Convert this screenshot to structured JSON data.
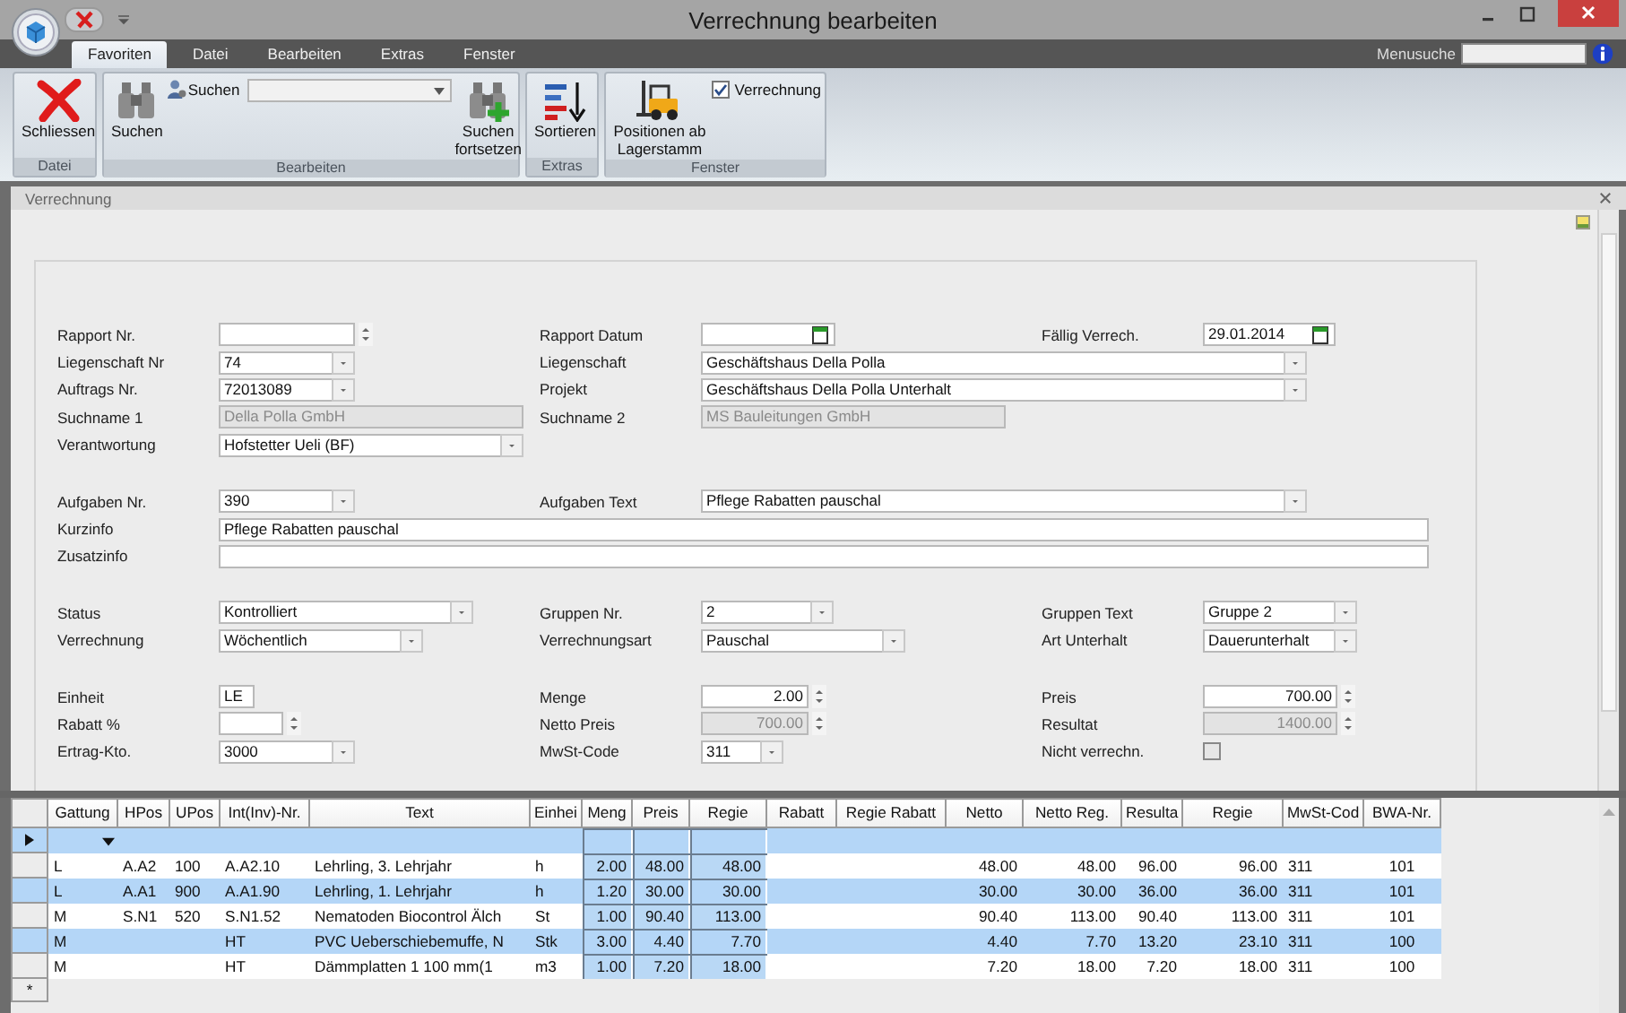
{
  "window": {
    "title": "Verrechnung bearbeiten"
  },
  "ribbon": {
    "tabs": [
      {
        "label": "Favoriten",
        "selected": true
      },
      {
        "label": "Datei",
        "selected": false
      },
      {
        "label": "Bearbeiten",
        "selected": false
      },
      {
        "label": "Extras",
        "selected": false
      },
      {
        "label": "Fenster",
        "selected": false
      }
    ],
    "menu_search": {
      "label": "Menusuche"
    },
    "groups": [
      {
        "label": "Datei",
        "items": [
          {
            "kind": "large",
            "label": "Schliessen"
          }
        ]
      },
      {
        "label": "Bearbeiten",
        "items": [
          {
            "kind": "large",
            "label": "Suchen"
          },
          {
            "kind": "search",
            "label": "Suchen"
          },
          {
            "kind": "large",
            "label": "Suchen fortsetzen"
          }
        ]
      },
      {
        "label": "Extras",
        "items": [
          {
            "kind": "large",
            "label": "Sortieren"
          }
        ]
      },
      {
        "label": "Fenster",
        "items": [
          {
            "kind": "large",
            "label": "Positionen ab Lagerstamm"
          },
          {
            "kind": "checkbox",
            "label": "Verrechnung",
            "checked": true
          }
        ]
      }
    ]
  },
  "panel": {
    "title": "Verrechnung"
  },
  "form": {
    "sections": [
      {
        "rows": [
          [
            {
              "label": "Rapport Nr.",
              "kind": "spin",
              "disabled": false
            },
            {
              "label": "Rapport Datum",
              "kind": "date"
            },
            {
              "label": "Fällig Verrech.",
              "kind": "date",
              "value": "29.01.2014"
            }
          ],
          [
            {
              "label": "Liegenschaft Nr",
              "kind": "combo",
              "value": "74"
            },
            {
              "label": "Liegenschaft",
              "kind": "combo",
              "value": "Geschäftshaus Della Polla"
            }
          ],
          [
            {
              "label": "Auftrags Nr.",
              "kind": "combo",
              "value": "72013089"
            },
            {
              "label": "Projekt",
              "kind": "combo",
              "value": "Geschäftshaus Della Polla Unterhalt"
            }
          ],
          [
            {
              "label": "Suchname 1",
              "kind": "text",
              "value": "Della Polla GmbH",
              "disabled": true
            },
            {
              "label": "Suchname 2",
              "kind": "text",
              "value": "MS Bauleitungen GmbH",
              "disabled": true
            }
          ],
          [
            {
              "label": "Verantwortung",
              "kind": "combo",
              "value": "Hofstetter Ueli (BF)"
            }
          ]
        ]
      },
      {
        "rows": [
          [
            {
              "label": "Aufgaben Nr.",
              "kind": "combo",
              "value": "390"
            },
            {
              "label": "Aufgaben Text",
              "kind": "combo",
              "value": "Pflege Rabatten pauschal"
            }
          ],
          [
            {
              "label": "Kurzinfo",
              "kind": "text",
              "value": "Pflege Rabatten pauschal",
              "disabled": false
            }
          ],
          [
            {
              "label": "Zusatzinfo",
              "kind": "text",
              "disabled": false
            }
          ]
        ]
      },
      {
        "rows": [
          [
            {
              "label": "Status",
              "kind": "combo",
              "value": "Kontrolliert"
            },
            {
              "label": "Gruppen Nr.",
              "kind": "combo",
              "value": "2"
            },
            {
              "label": "Gruppen Text",
              "kind": "combo",
              "value": "Gruppe 2"
            }
          ],
          [
            {
              "label": "Verrechnung",
              "kind": "combo",
              "value": "Wöchentlich"
            },
            {
              "label": "Verrechnungsart",
              "kind": "combo",
              "value": "Pauschal"
            },
            {
              "label": "Art Unterhalt",
              "kind": "combo",
              "value": "Dauerunterhalt"
            }
          ]
        ]
      },
      {
        "rows": [
          [
            {
              "label": "Einheit",
              "kind": "text",
              "value": "LE",
              "disabled": false
            },
            {
              "label": "Menge",
              "kind": "spin",
              "value": "2.00",
              "disabled": false
            },
            {
              "label": "Preis",
              "kind": "spin",
              "value": "700.00",
              "disabled": false
            }
          ],
          [
            {
              "label": "Rabatt %",
              "kind": "spin",
              "disabled": false
            },
            {
              "label": "Netto Preis",
              "kind": "spin",
              "value": "700.00",
              "disabled": true
            },
            {
              "label": "Resultat",
              "kind": "spin",
              "value": "1400.00",
              "disabled": true
            }
          ],
          [
            {
              "label": "Ertrag-Kto.",
              "kind": "combo",
              "value": "3000"
            },
            {
              "label": "MwSt-Code",
              "kind": "combo",
              "value": "311"
            },
            {
              "label": "Nicht verrechn.",
              "kind": "checkbox",
              "checked": false
            }
          ]
        ]
      }
    ]
  },
  "table": {
    "columns": [
      "Gattung",
      "HPos",
      "UPos",
      "Int(Inv)-Nr.",
      "Text",
      "Einhei",
      "Meng",
      "Preis",
      "Regie",
      "Rabatt",
      "Regie Rabatt",
      "Netto",
      "Netto Reg.",
      "Resulta",
      "Regie",
      "MwSt-Cod",
      "BWA-Nr."
    ],
    "rows": [
      {
        "cells": [
          "L",
          "A.A2",
          "100",
          "A.A2.10",
          "Lehrling, 3. Lehrjahr",
          "h",
          "2.00",
          "48.00",
          "48.00",
          null,
          null,
          "48.00",
          "48.00",
          "96.00",
          "96.00",
          "311",
          "101"
        ]
      },
      {
        "cells": [
          "L",
          "A.A1",
          "900",
          "A.A1.90",
          "Lehrling, 1. Lehrjahr",
          "h",
          "1.20",
          "30.00",
          "30.00",
          null,
          null,
          "30.00",
          "30.00",
          "36.00",
          "36.00",
          "311",
          "101"
        ]
      },
      {
        "cells": [
          "M",
          "S.N1",
          "520",
          "S.N1.52",
          "Nematoden Biocontrol Älch",
          "St",
          "1.00",
          "90.40",
          "113.00",
          null,
          null,
          "90.40",
          "113.00",
          "90.40",
          "113.00",
          "311",
          "101"
        ]
      },
      {
        "cells": [
          "M",
          null,
          null,
          "HT",
          "PVC Ueberschiebemuffe, N",
          "Stk",
          "3.00",
          "4.40",
          "7.70",
          null,
          null,
          "4.40",
          "7.70",
          "13.20",
          "23.10",
          "311",
          "100"
        ]
      },
      {
        "cells": [
          "M",
          null,
          null,
          "HT",
          "Dämmplatten 1 100 mm(1",
          "m3",
          "1.00",
          "7.20",
          "18.00",
          null,
          null,
          "7.20",
          "18.00",
          "7.20",
          "18.00",
          "311",
          "100"
        ]
      }
    ],
    "new_row_marker": "*"
  }
}
